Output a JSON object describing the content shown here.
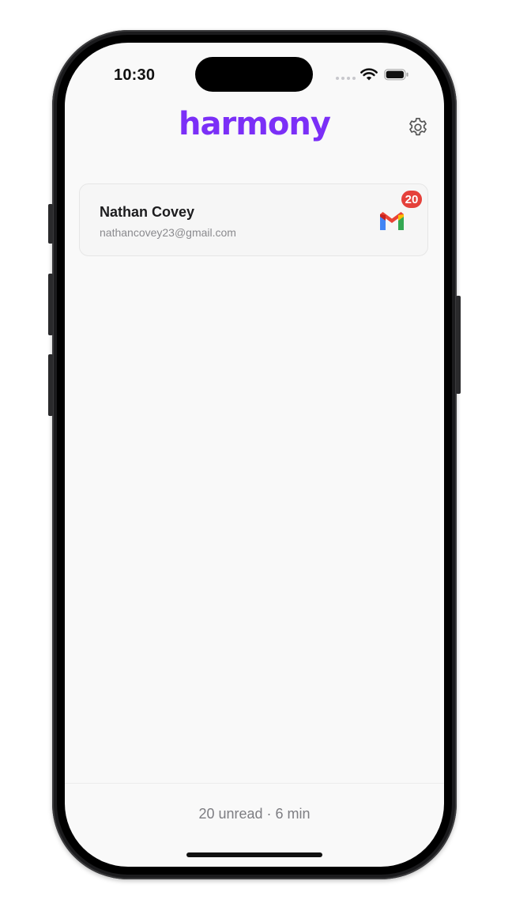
{
  "status_bar": {
    "time": "10:30",
    "icons": [
      "cellular-signal-icon",
      "wifi-icon",
      "battery-icon"
    ]
  },
  "header": {
    "logo_text": "harmony",
    "settings_icon": "gear-icon"
  },
  "accounts": [
    {
      "name": "Nathan Covey",
      "email": "nathancovey23@gmail.com",
      "provider_icon": "gmail-icon",
      "unread_count": "20"
    }
  ],
  "footer": {
    "summary": "20 unread · 6 min"
  },
  "colors": {
    "brand": "#7b2ff7",
    "badge": "#e5413b",
    "background": "#f9f9f9"
  }
}
